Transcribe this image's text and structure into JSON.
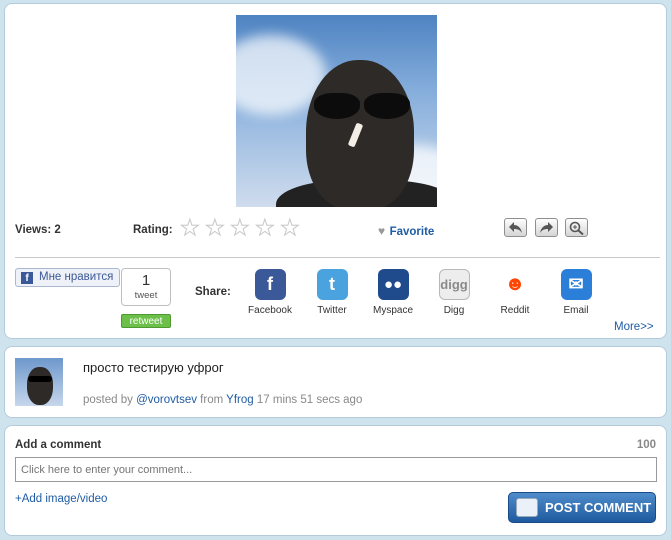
{
  "media": {
    "views_label": "Views: 2",
    "rating_label": "Rating:",
    "rating": 0,
    "rating_max": 5,
    "favorite_label": "Favorite"
  },
  "social": {
    "like_label": "Мне нравится",
    "tweet_count": "1",
    "tweet_label": "tweet",
    "retweet_label": "retweet",
    "share_label": "Share:",
    "networks": [
      {
        "name": "Facebook",
        "icon": "facebook-icon",
        "color": "#3b5998"
      },
      {
        "name": "Twitter",
        "icon": "twitter-icon",
        "color": "#4aa3df"
      },
      {
        "name": "Myspace",
        "icon": "myspace-icon",
        "color": "#1f4a8c"
      },
      {
        "name": "Digg",
        "icon": "digg-icon",
        "color": "#b8b8b8"
      },
      {
        "name": "Reddit",
        "icon": "reddit-icon",
        "color": "#ff4500"
      },
      {
        "name": "Email",
        "icon": "email-icon",
        "color": "#2b7fd8"
      }
    ],
    "more_label": "More>>"
  },
  "post": {
    "text": "просто тестирую уфрог",
    "posted_by": "posted by",
    "user": "@vorovtsev",
    "from": "from",
    "source": "Yfrog",
    "time": "17 mins 51 secs ago"
  },
  "comment": {
    "title": "Add a comment",
    "counter": "100",
    "placeholder": "Click here to enter your comment...",
    "add_media": "+Add image/video",
    "submit": "POST COMMENT"
  }
}
